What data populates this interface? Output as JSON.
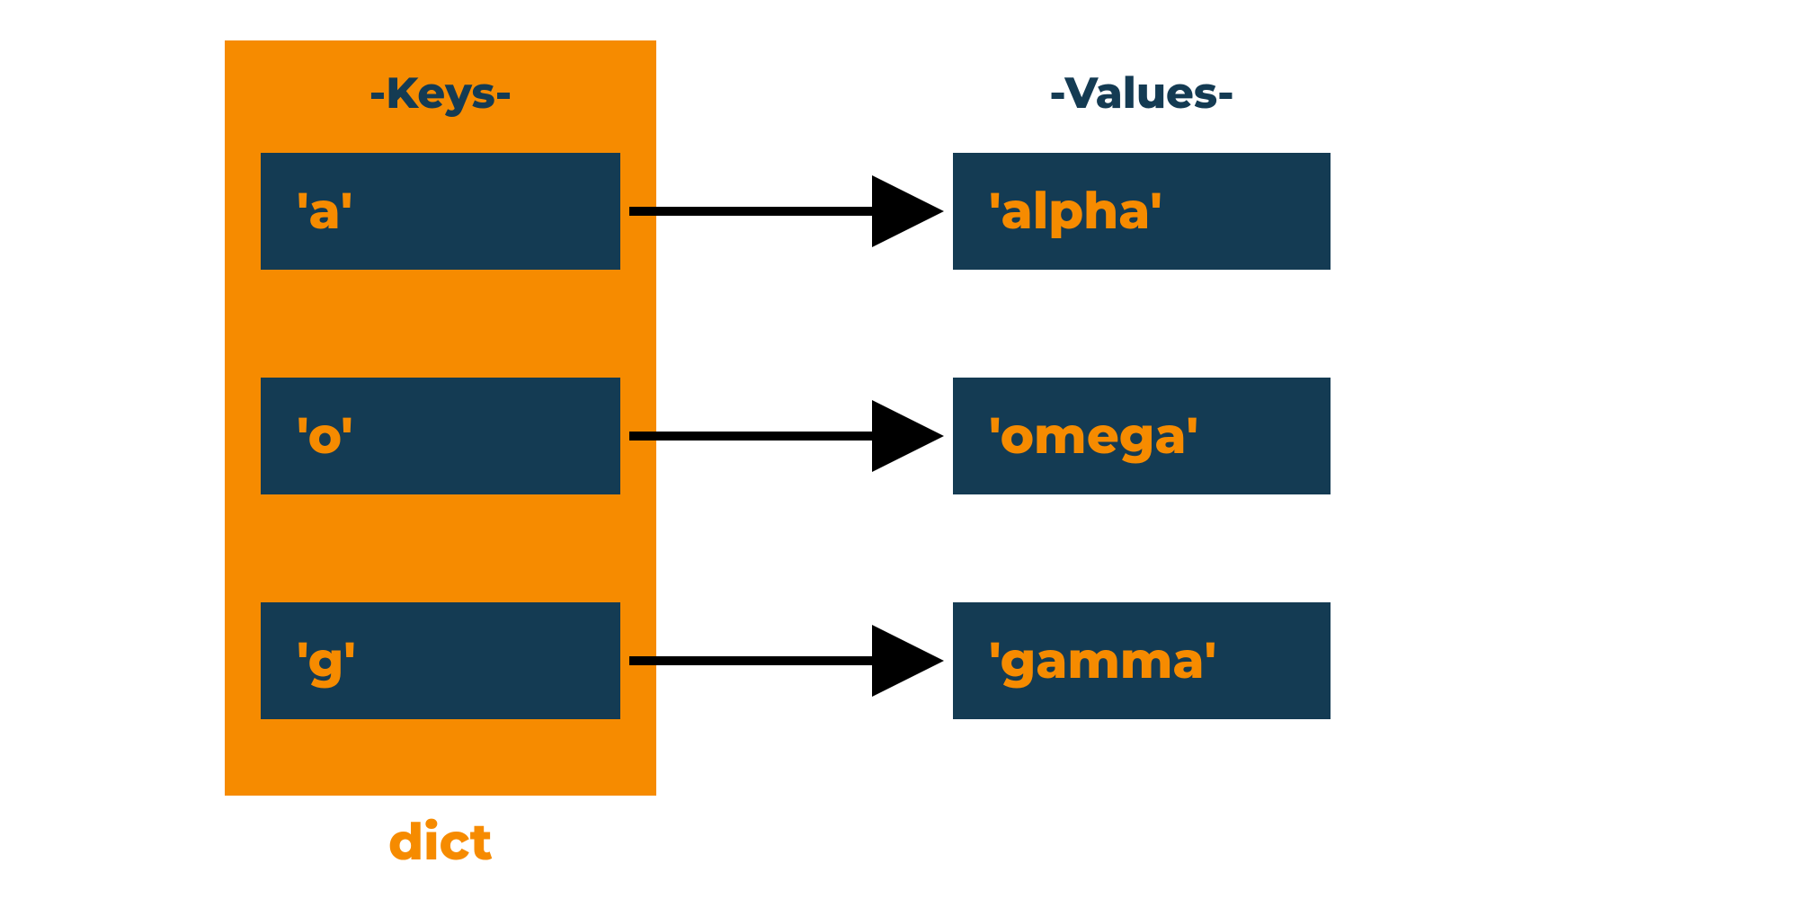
{
  "headings": {
    "keys": "-Keys-",
    "values": "-Values-"
  },
  "dict_label": "dict",
  "pairs": [
    {
      "key": "'a'",
      "value": "'alpha'"
    },
    {
      "key": "'o'",
      "value": "'omega'"
    },
    {
      "key": "'g'",
      "value": "'gamma'"
    }
  ],
  "colors": {
    "container": "#f68b00",
    "cell_bg": "#143b53",
    "cell_text": "#f68b00",
    "heading_text": "#143b53",
    "arrow": "#000000"
  }
}
